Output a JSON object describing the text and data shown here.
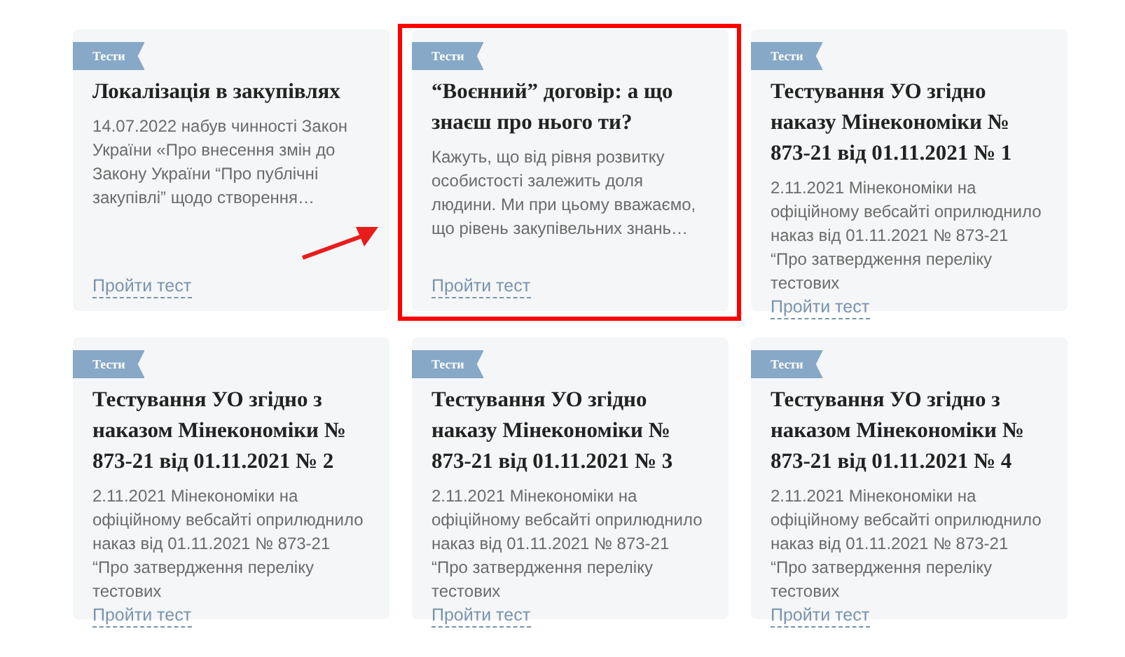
{
  "cards": [
    {
      "tag": "Тести",
      "title": "Локалізація в закупівлях",
      "description": "14.07.2022 набув чинності Закон України «Про внесення змін до Закону України “Про публічні закупівлі” щодо створення…",
      "link": "Пройти тест",
      "highlighted": false
    },
    {
      "tag": "Тести",
      "title": "“Воєнний” договір: а що знаєш про нього ти?",
      "description": "Кажуть, що від рівня розвитку особистості залежить доля людини. Ми при цьому вважаємо, що рівень закупівельних знань…",
      "link": "Пройти тест",
      "highlighted": true
    },
    {
      "tag": "Тести",
      "title": "Тестування УО згідно наказу Мінекономіки № 873-21 від 01.11.2021 № 1",
      "description": "2.11.2021 Мінекономіки на офіційному вебсайті оприлюднило наказ від 01.11.2021 № 873-21 “Про затвердження переліку тестових",
      "link": "Пройти тест",
      "highlighted": false
    },
    {
      "tag": "Тести",
      "title": "Тестування УО згідно з наказом Мінекономіки № 873-21 від 01.11.2021 № 2",
      "description": "2.11.2021 Мінекономіки на офіційному вебсайті оприлюднило наказ від 01.11.2021 № 873-21 “Про затвердження переліку тестових",
      "link": "Пройти тест",
      "highlighted": false
    },
    {
      "tag": "Тести",
      "title": "Тестування УО згідно наказу Мінекономіки № 873-21 від 01.11.2021 № 3",
      "description": "2.11.2021 Мінекономіки на офіційному вебсайті оприлюднило наказ від 01.11.2021 № 873-21 “Про затвердження переліку тестових",
      "link": "Пройти тест",
      "highlighted": false
    },
    {
      "tag": "Тести",
      "title": "Тестування УО згідно з наказом Мінекономіки № 873-21 від 01.11.2021 № 4",
      "description": "2.11.2021 Мінекономіки на офіційному вебсайті оприлюднило наказ від 01.11.2021 № 873-21 “Про затвердження переліку тестових",
      "link": "Пройти тест",
      "highlighted": false
    }
  ]
}
